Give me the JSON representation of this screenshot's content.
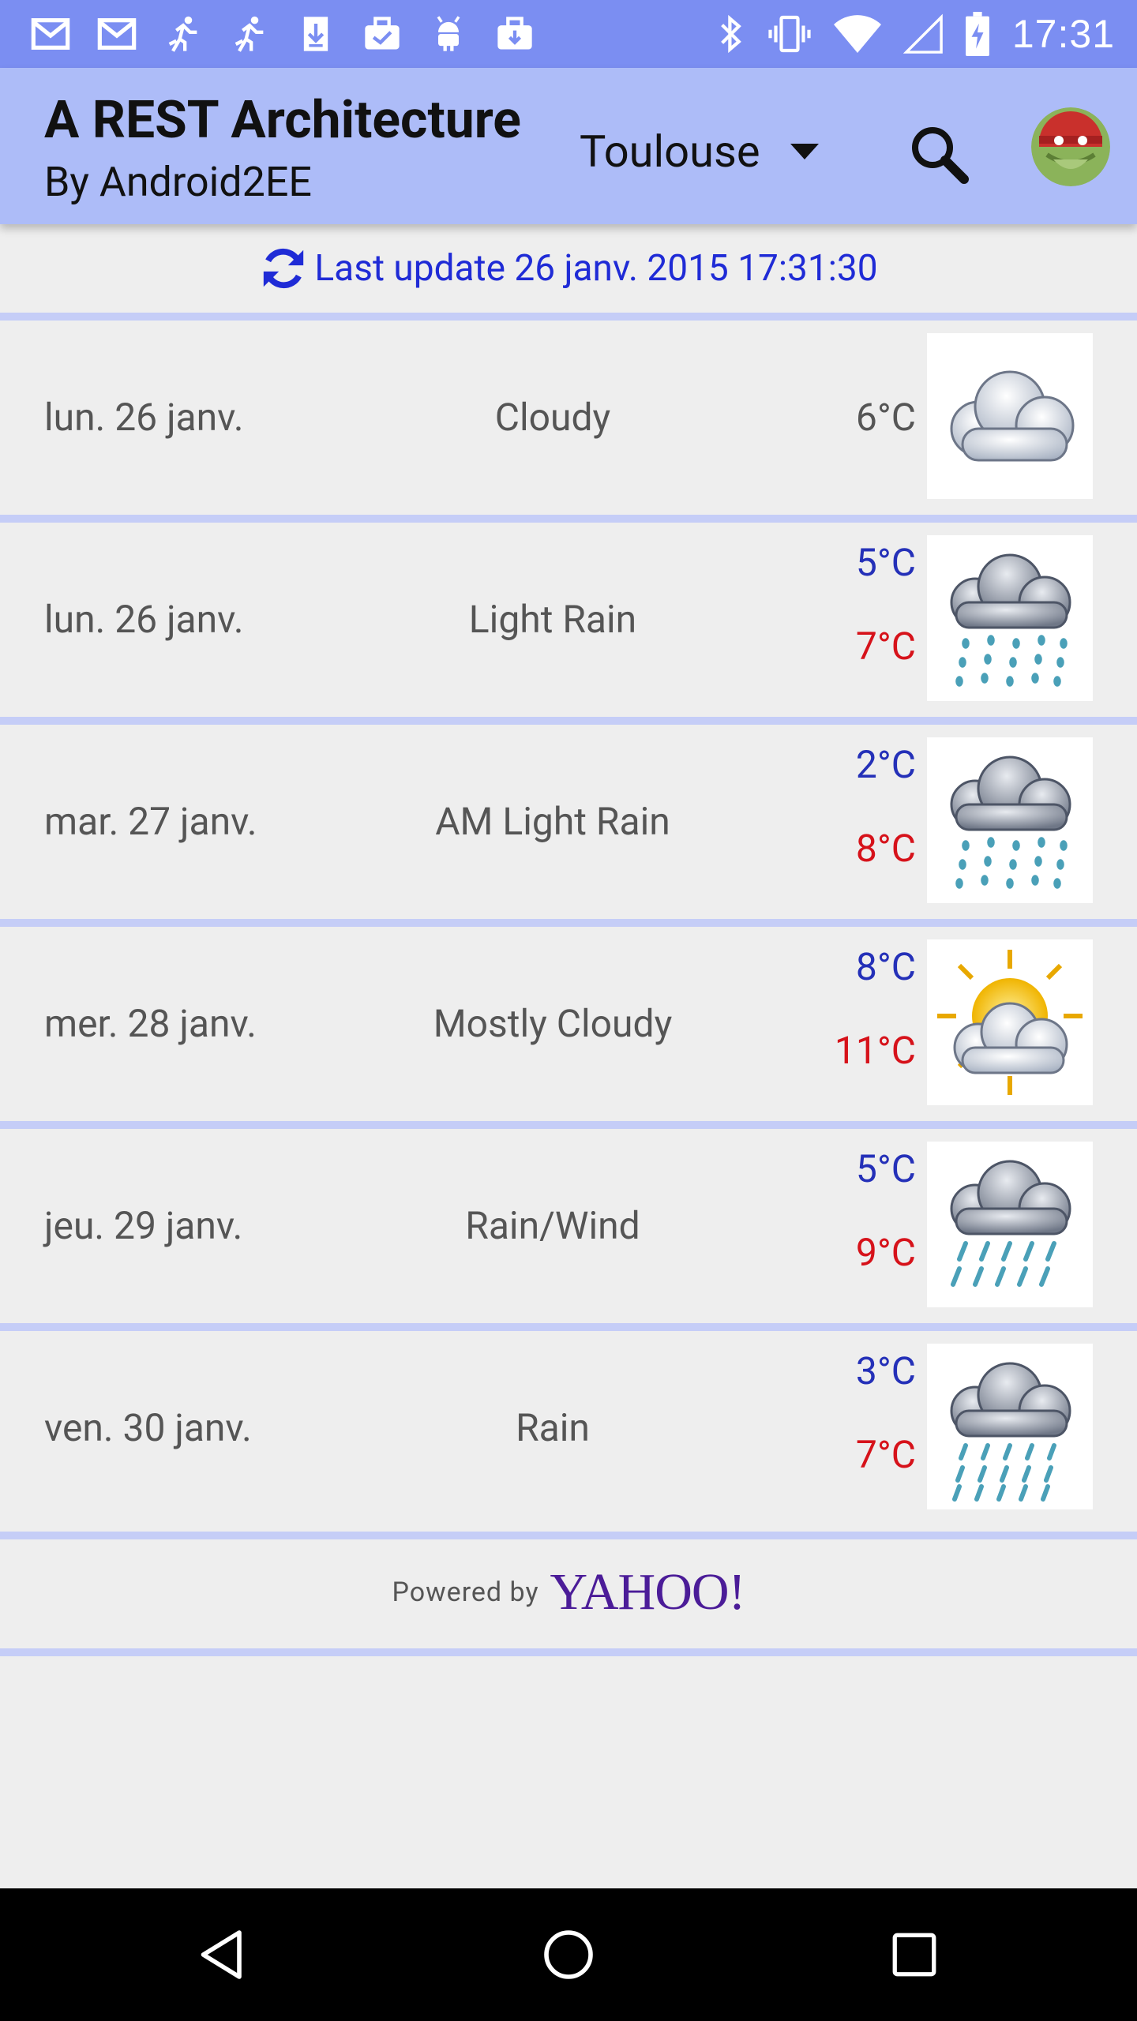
{
  "status_bar": {
    "time": "17:31",
    "icons": [
      "gmail-icon",
      "gmail-icon",
      "runner-icon",
      "runner-icon",
      "download-icon",
      "briefcase-check-icon",
      "android-icon",
      "briefcase-icon"
    ],
    "right_icons": [
      "bluetooth-icon",
      "vibrate-icon",
      "wifi-icon",
      "signal-icon",
      "battery-charging-icon"
    ]
  },
  "app_bar": {
    "title": "A REST Architecture",
    "subtitle": "By Android2EE",
    "city": "Toulouse",
    "search_icon": "search-icon",
    "avatar_icon": "android-avatar-icon"
  },
  "update": {
    "text": "Last update 26 janv. 2015 17:31:30",
    "icon": "refresh-icon"
  },
  "forecast": [
    {
      "date": "lun. 26 janv.",
      "desc": "Cloudy",
      "temp": "6°C",
      "icon": "cloudy-icon"
    },
    {
      "date": "lun. 26 janv.",
      "desc": "Light Rain",
      "low": "5°C",
      "high": "7°C",
      "icon": "light-rain-icon"
    },
    {
      "date": "mar. 27 janv.",
      "desc": "AM Light Rain",
      "low": "2°C",
      "high": "8°C",
      "icon": "light-rain-icon"
    },
    {
      "date": "mer. 28 janv.",
      "desc": "Mostly Cloudy",
      "low": "8°C",
      "high": "11°C",
      "icon": "mostly-cloudy-icon"
    },
    {
      "date": "jeu. 29 janv.",
      "desc": "Rain/Wind",
      "low": "5°C",
      "high": "9°C",
      "icon": "rain-wind-icon"
    },
    {
      "date": "ven. 30 janv.",
      "desc": "Rain",
      "low": "3°C",
      "high": "7°C",
      "icon": "rain-icon"
    }
  ],
  "footer": {
    "powered_by": "Powered by",
    "brand": "YAHOO!"
  },
  "nav": {
    "back": "back-icon",
    "home": "home-icon",
    "recents": "recents-icon"
  },
  "colors": {
    "status_bar": "#7b8ef2",
    "app_bar": "#adbcf8",
    "update_text": "#1f2bd6",
    "temp_low": "#2430b8",
    "temp_high": "#d6121a",
    "divider": "#c5cdf7",
    "yahoo": "#4b1c98"
  }
}
